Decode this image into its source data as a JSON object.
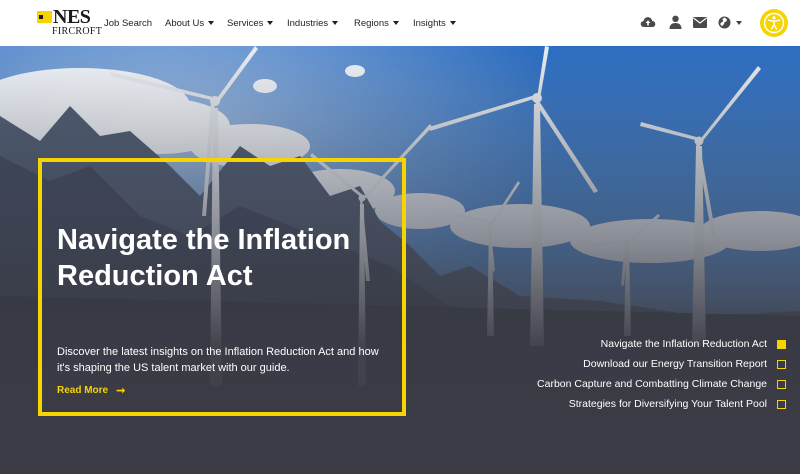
{
  "header": {
    "logo": {
      "nes": "NES",
      "fircroft": "FIRCROFT"
    },
    "nav": [
      {
        "label": "Job Search",
        "dropdown": false
      },
      {
        "label": "About Us",
        "dropdown": true
      },
      {
        "label": "Services",
        "dropdown": true
      },
      {
        "label": "Industries",
        "dropdown": true
      },
      {
        "label": "Regions",
        "dropdown": true
      },
      {
        "label": "Insights",
        "dropdown": true
      }
    ],
    "icons": [
      "cloud-upload-icon",
      "user-icon",
      "envelope-icon",
      "globe-icon",
      "accessibility-icon"
    ]
  },
  "hero": {
    "headline": "Navigate the Inflation Reduction Act",
    "description": "Discover the latest insights on the Inflation Reduction Act and how it's shaping the US talent market with our guide.",
    "cta": "Read More",
    "cta_arrow": "➞"
  },
  "slides": [
    {
      "label": "Navigate the Inflation Reduction Act",
      "active": true
    },
    {
      "label": "Download our Energy Transition Report",
      "active": false
    },
    {
      "label": "Carbon Capture and Combatting Climate Change",
      "active": false
    },
    {
      "label": "Strategies for Diversifying Your Talent Pool",
      "active": false
    }
  ],
  "colors": {
    "accent": "#f5d400",
    "dark": "#3a3b45",
    "header_bg": "#ffffff"
  }
}
